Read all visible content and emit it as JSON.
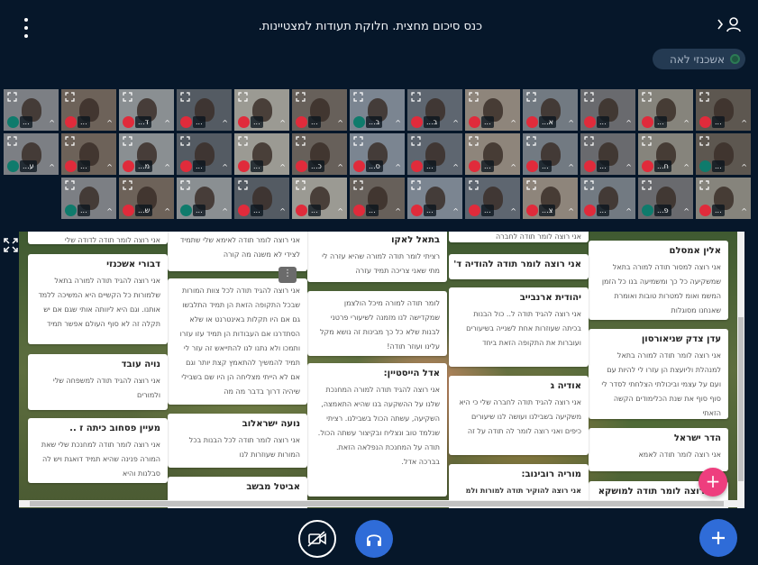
{
  "header": {
    "title": "כנס סיכום מחצית. חלוקת תעודות למצטיינות."
  },
  "presenter": {
    "name": "אשכנזי לאה"
  },
  "video_tiles": [
    {
      "label": "...",
      "mic": "listen"
    },
    {
      "label": "...",
      "mic": "muted"
    },
    {
      "label": "ד...",
      "mic": "muted"
    },
    {
      "label": "...",
      "mic": "muted"
    },
    {
      "label": "...",
      "mic": "muted"
    },
    {
      "label": "...",
      "mic": "muted"
    },
    {
      "label": "ב...",
      "mic": "listen"
    },
    {
      "label": "ב...",
      "mic": "muted"
    },
    {
      "label": "...",
      "mic": "muted"
    },
    {
      "label": "א...",
      "mic": "muted"
    },
    {
      "label": "...",
      "mic": "muted"
    },
    {
      "label": "...",
      "mic": "muted"
    },
    {
      "label": "...",
      "mic": "muted"
    },
    {
      "label": "ע...",
      "mic": "listen"
    },
    {
      "label": "...",
      "mic": "muted"
    },
    {
      "label": "מ...",
      "mic": "muted"
    },
    {
      "label": "...",
      "mic": "muted"
    },
    {
      "label": "...",
      "mic": "muted"
    },
    {
      "label": "כ...",
      "mic": "muted"
    },
    {
      "label": "ס...",
      "mic": "muted"
    },
    {
      "label": "...",
      "mic": "muted"
    },
    {
      "label": "...",
      "mic": "muted"
    },
    {
      "label": "...",
      "mic": "muted"
    },
    {
      "label": "...",
      "mic": "muted"
    },
    {
      "label": "ח...",
      "mic": "muted"
    },
    {
      "label": "...",
      "mic": "listen"
    },
    {
      "label": "...",
      "mic": "listen"
    },
    {
      "label": "ש...",
      "mic": "muted"
    },
    {
      "label": "...",
      "mic": "listen"
    },
    {
      "label": "...",
      "mic": "muted"
    },
    {
      "label": "...",
      "mic": "muted"
    },
    {
      "label": "...",
      "mic": "muted"
    },
    {
      "label": "...",
      "mic": "muted"
    },
    {
      "label": "...",
      "mic": "muted"
    },
    {
      "label": "צ...",
      "mic": "muted"
    },
    {
      "label": "...",
      "mic": "muted"
    },
    {
      "label": "פ...",
      "mic": "listen"
    },
    {
      "label": "...",
      "mic": "muted"
    }
  ],
  "board": {
    "columns": [
      {
        "cards": [
          {
            "title": "אלין אמסלם",
            "body": "אני רוצה למסור תודה למורה בתאל שמשקיעה כל כך ומשמיעה בנו כל הזמן המשמ ואומ למטרות טובות ואומרת שאנחנו מסוגלות"
          },
          {
            "title": "עדן צדק שניאורסון",
            "body": "אני רוצה לומר תודה למורה בתאל למנהלת וליועצת הן עזרו לי להיות עם ועם על עצמי וביכולתי הצלחתי לסדר לי סוף סוף את שנת הכלימודים הקשה הזאתי"
          },
          {
            "title": "הדר ישראל",
            "body": "אני רוצה לומר תודה לאמא"
          },
          {
            "title": "אני רוצה לומר תודה למושקא",
            "body": ""
          }
        ]
      },
      {
        "cards": [
          {
            "title": "",
            "body": "אני רוצה לומר תודה לחברה"
          },
          {
            "title": "אני רוצה לומר תודה להודיה ד'",
            "body": ""
          },
          {
            "title": "יהודית ארנבייב",
            "body": "אני רוצה להגיד תודה ל.. כול הבנות בכיתה שעוזרות אחת לשנייה בשיעורים ועוברות את התקופה הזאת ביחד"
          },
          {
            "title": "אודיה ג",
            "body": "אני רוצה להגיד תודה לחברה שלי כי היא משקיעה בשבילנו ועושה לנו שיעורים כיפים ואני רוצה לומר לה תודה על זה"
          },
          {
            "title": "מוריה רובינוב:",
            "body": "אני רוצה להוקיר תודה למורות ולמ"
          }
        ]
      },
      {
        "cards": [
          {
            "title": "בתאל לאקו",
            "body": "רציתי לומר תודה למורה שהיא עזרה לי מתי שאני צריכה תמיד עזרה"
          },
          {
            "title": "",
            "body": "לומר תודה למורה מיכל הולצמן שמקדישה לנו מזמנה לשיעורי פרטני לבנות שלא כל כך מבינות זה נושא מקל עלינו ועוזר תודה!"
          },
          {
            "title": "אדל הייסטיין:",
            "body": "אני רוצה להגיד תודה למורה המחנכת שלנו על ההשקעה בנו שהיא התאמצה, השקיעה, עשתה הכול בשבילנו. רציתי שנלמד טוב ונצליח ובקיצור עשתה הכול. תודה על המחנכת הנפלאה הזאת. בברכה אדל."
          }
        ]
      },
      {
        "cards": [
          {
            "title": "",
            "body": "אני רוצה לומר תודה לאימא שלי שתמיד לצידי לא משנה מה קורה"
          },
          {
            "title": "",
            "body": "אני רוצה להגיד תודה לכל צוות המורות שבכל התקופה הזאת הן תמיד התלבשו גם אם היו תקלות באינטרנט או שלא הסתדרנו אם העבודות הן תמיד עזו עזרו ותמכו ולא נתנו לנו להתייאש זה עזר לי תמיד להמשיך להתאמץ קצת יותר וגם אם לא הייתי מצליחה הן היו שם בשבילי שיהיה דרוך בדבר מה מה"
          },
          {
            "title": "נועה ישראלוב",
            "body": "אני רוצה לומר תודה לכל הבנות בכל המורות שעוזרות לנו"
          },
          {
            "title": "אביטל מבשב",
            "body": ""
          }
        ]
      },
      {
        "cards": [
          {
            "title": "",
            "body": "אני רוצה לומר תודה לדודה שלי"
          },
          {
            "title": "דבורי אשכנזי",
            "body": "אני רוצה להגיד תודה למורה בתאל שלמורות כל הקשיים היא המשיכה ללמד אותנו. וגם היא ליוותה אותי שגם אם יש תקלה זה לא סוף העולם אפשר תמיד"
          },
          {
            "title": "נויה עובד",
            "body": "אני רוצה להגיד תודה למשפחה שלי ולמורים"
          },
          {
            "title": "מעיין פסחוב כיתה ז ..",
            "body": "אני רוצה לומר תודה למחנכת שלי שאת המורה פנינה שהיא תמיד דואגת ויש לה סבלנות והיא"
          }
        ]
      }
    ],
    "menu_dots": "⋮"
  },
  "controls": {
    "fab_plus": "+",
    "pink_plus": "+"
  },
  "colors": {
    "background": "#06172a",
    "primary_blue": "#2f6cd8",
    "muted_red": "#e02b3b",
    "listen_teal": "#0f7b6c",
    "fab_pink": "#ee3e7e"
  }
}
